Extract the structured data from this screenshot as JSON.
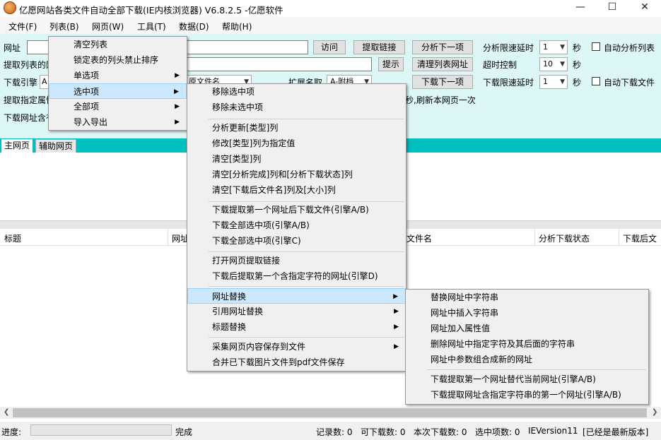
{
  "window": {
    "title": "亿愿网站各类文件自动全部下载(IE内核浏览器) V6.8.2.5 -亿愿软件",
    "min": "—",
    "max": "☐",
    "close": "✕"
  },
  "menubar": [
    "文件(F)",
    "列表(B)",
    "网页(W)",
    "工具(T)",
    "数据(D)",
    "帮助(H)"
  ],
  "toolbar": {
    "url_label": "网址",
    "visit": "访问",
    "extract_links": "提取链接",
    "analyze_next": "分析下一项",
    "analyze_delay_label": "分析限速延时",
    "analyze_delay_value": "1",
    "sec1": "秒",
    "auto_analyze": "自动分析列表",
    "extract_list_label": "提取列表的网",
    "hint": "提示",
    "clean_list_urls": "清理列表网址",
    "timeout_label": "超时控制",
    "timeout_value": "10",
    "sec2": "秒",
    "engine_label": "下载引擎",
    "engine_value": "A",
    "filename_combo": "原文件名",
    "ext_label": "扩展名取",
    "ext_value": "A-附档",
    "download_next": "下载下一项",
    "download_delay_label": "下载限速延时",
    "download_delay_value": "1",
    "sec3": "秒",
    "auto_download": "自动下载文件",
    "extract_attr_label": "提取指定属性",
    "refresh_text": "秒,刷新本网页一次",
    "download_contains_label": "下载网址含有"
  },
  "tabs": [
    "主网页",
    "辅助网页"
  ],
  "columns": [
    "标题",
    "网址",
    "文件名",
    "分析下载状态",
    "下载后文"
  ],
  "status": {
    "progress_label": "进度:",
    "done": "完成",
    "records": "记录数: 0",
    "downloadable": "可下载数: 0",
    "this_download": "本次下载数: 0",
    "selected": "选中项数: 0",
    "ie": "IEVersion11",
    "latest": "[已经是最新版本]"
  },
  "menu1": [
    "清空列表",
    "锁定表的列头禁止排序",
    "单选项",
    "选中项",
    "全部项",
    "导入导出"
  ],
  "menu2": [
    "移除选中项",
    "移除未选中项",
    "分析更新[类型]列",
    "修改[类型]列为指定值",
    "清空[类型]列",
    "清空[分析完成]列和[分析下载状态]列",
    "清空[下载后文件名]列及[大小]列",
    "下载提取第一个网址后下载文件(引擎A/B)",
    "下载全部选中项(引擎A/B)",
    "下载全部选中项(引擎C)",
    "打开网页提取链接",
    "下载后提取第一个含指定字符的网址(引擎D)",
    "网址替换",
    "引用网址替换",
    "标题替换",
    "采集网页内容保存到文件",
    "合并已下载图片文件到pdf文件保存"
  ],
  "menu3": [
    "替换网址中字符串",
    "网址中插入字符串",
    "网址加入属性值",
    "删除网址中指定字符及其后面的字符串",
    "网址中参数组合成新的网址",
    "下载提取第一个网址替代当前网址(引擎A/B)",
    "下载提取网址含指定字符串的第一个网址(引擎A/B)"
  ]
}
